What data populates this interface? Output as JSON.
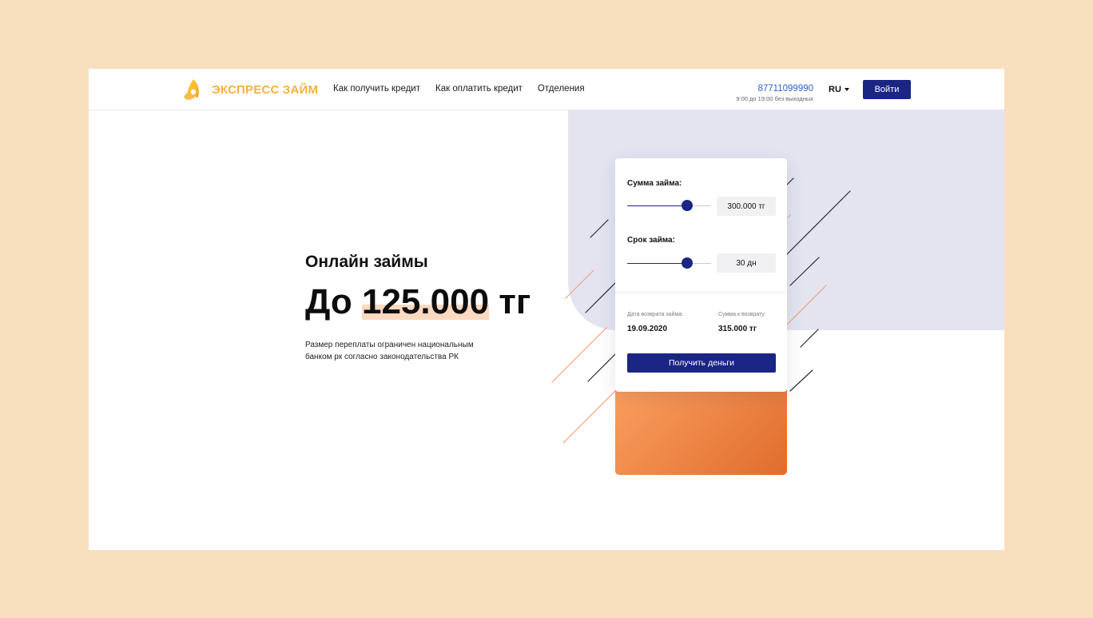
{
  "brand": {
    "name": "ЭКСПРЕСС ЗАЙМ",
    "color": "#f6b13f"
  },
  "nav": [
    {
      "label": "Как получить кредит"
    },
    {
      "label": "Как оплатить кредит"
    },
    {
      "label": "Отделения"
    }
  ],
  "contact": {
    "phone": "87711099990",
    "hours": "9:00 до 19:00 без выходных"
  },
  "language": {
    "selected": "RU"
  },
  "login_label": "Войти",
  "hero": {
    "subtitle": "Онлайн займы",
    "title_prefix": "До ",
    "title_amount": "125.000",
    "title_suffix": " тг",
    "description": "Размер переплаты ограничен национальным банком рк согласно законодательства РК"
  },
  "calculator": {
    "amount": {
      "label": "Сумма займа:",
      "value": "300.000 тг",
      "slider_level": 0.71
    },
    "term": {
      "label": "Срок займа:",
      "value": "30 дн",
      "slider_level": 0.71
    },
    "return_date": {
      "label": "Дата возврата займа:",
      "value": "19.09.2020"
    },
    "return_sum": {
      "label": "Сумма к возврату:",
      "value": "315.000 тг"
    },
    "submit_label": "Получить деньги"
  },
  "colors": {
    "accent": "#1b2584",
    "background": "#f8dfbd",
    "panel": "#e3e4f0",
    "orange": "#f2884a"
  }
}
